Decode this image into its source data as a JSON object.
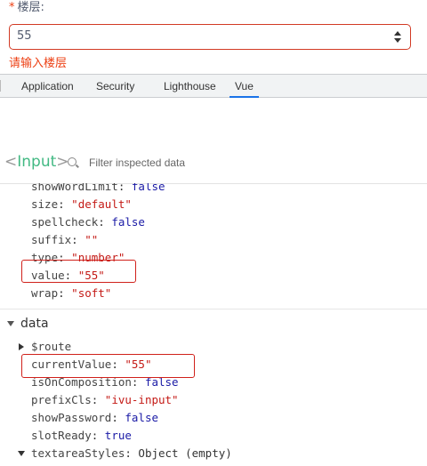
{
  "form": {
    "required_mark": "*",
    "label": "楼层:",
    "input_value": "55",
    "error": "请输入楼层"
  },
  "devtools": {
    "tabs": [
      {
        "label": "Application",
        "active": false
      },
      {
        "label": "Security",
        "active": false
      },
      {
        "label": "Lighthouse",
        "active": false
      },
      {
        "label": "Vue",
        "active": true
      }
    ]
  },
  "vue": {
    "component": {
      "open": "<",
      "name": "Input",
      "close": ">"
    },
    "filter_placeholder": "Filter inspected data",
    "props": [
      {
        "key": "showWordLimit",
        "value": "false",
        "kind": "bool"
      },
      {
        "key": "size",
        "value": "\"default\"",
        "kind": "str"
      },
      {
        "key": "spellcheck",
        "value": "false",
        "kind": "bool"
      },
      {
        "key": "suffix",
        "value": "\"\"",
        "kind": "str"
      },
      {
        "key": "type",
        "value": "\"number\"",
        "kind": "str"
      },
      {
        "key": "value",
        "value": "\"55\"",
        "kind": "str"
      },
      {
        "key": "wrap",
        "value": "\"soft\"",
        "kind": "str"
      }
    ],
    "data_section": "data",
    "data": [
      {
        "key": "$route",
        "value": "",
        "kind": "expandable"
      },
      {
        "key": "currentValue",
        "value": "\"55\"",
        "kind": "str"
      },
      {
        "key": "isOnComposition",
        "value": "false",
        "kind": "bool"
      },
      {
        "key": "prefixCls",
        "value": "\"ivu-input\"",
        "kind": "str"
      },
      {
        "key": "showPassword",
        "value": "false",
        "kind": "bool"
      },
      {
        "key": "slotReady",
        "value": "true",
        "kind": "bool"
      },
      {
        "key": "textareaStyles",
        "value": "Object (empty)",
        "kind": "obj-expanded"
      }
    ]
  },
  "colors": {
    "error": "#ed4014",
    "highlight_box": "#d0211b",
    "vue_green": "#42b983",
    "active_tab_underline": "#1a73e8"
  }
}
